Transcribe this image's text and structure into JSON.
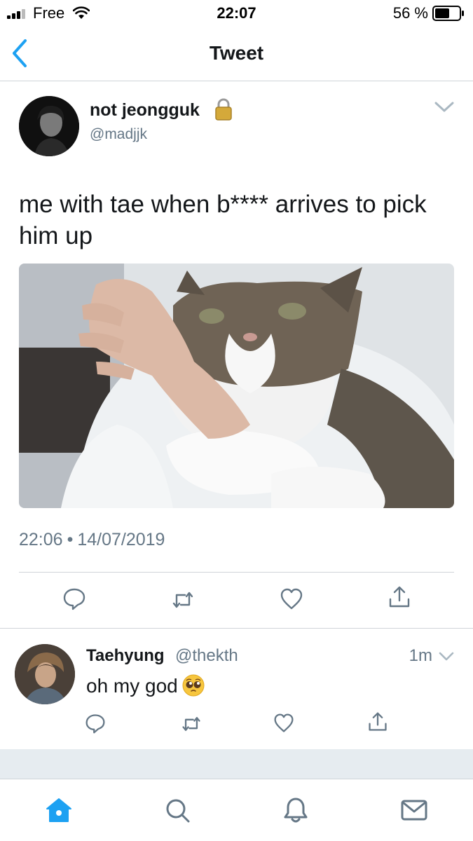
{
  "status_bar": {
    "carrier": "Free",
    "time": "22:07",
    "battery_percent": "56 %"
  },
  "nav": {
    "title": "Tweet",
    "back_icon": "chevron-left-icon"
  },
  "tweet": {
    "author_name": "not jeongguk",
    "author_handle": "@madjjk",
    "protected_icon": "lock-icon",
    "text": "me with tae when b**** arrives to pick him up",
    "media_description": "cat-photo",
    "time": "22:06",
    "separator": "•",
    "date": "14/07/2019",
    "actions": [
      "reply-icon",
      "retweet-icon",
      "like-icon",
      "share-icon"
    ]
  },
  "reply": {
    "author_name": "Taehyung",
    "author_handle": "@thekth",
    "time": "1m",
    "text": "oh my god",
    "emoji": "pleading-face-emoji",
    "actions": [
      "reply-icon",
      "retweet-icon",
      "like-icon",
      "share-icon"
    ]
  },
  "tab_bar": {
    "tabs": [
      "home-icon",
      "search-icon",
      "notifications-icon",
      "messages-icon"
    ],
    "active": "home-icon"
  },
  "colors": {
    "accent": "#1da1f2",
    "text": "#14171a",
    "secondary_text": "#657786",
    "divider": "#cfd4d8",
    "background_gap": "#e6ecf0"
  }
}
